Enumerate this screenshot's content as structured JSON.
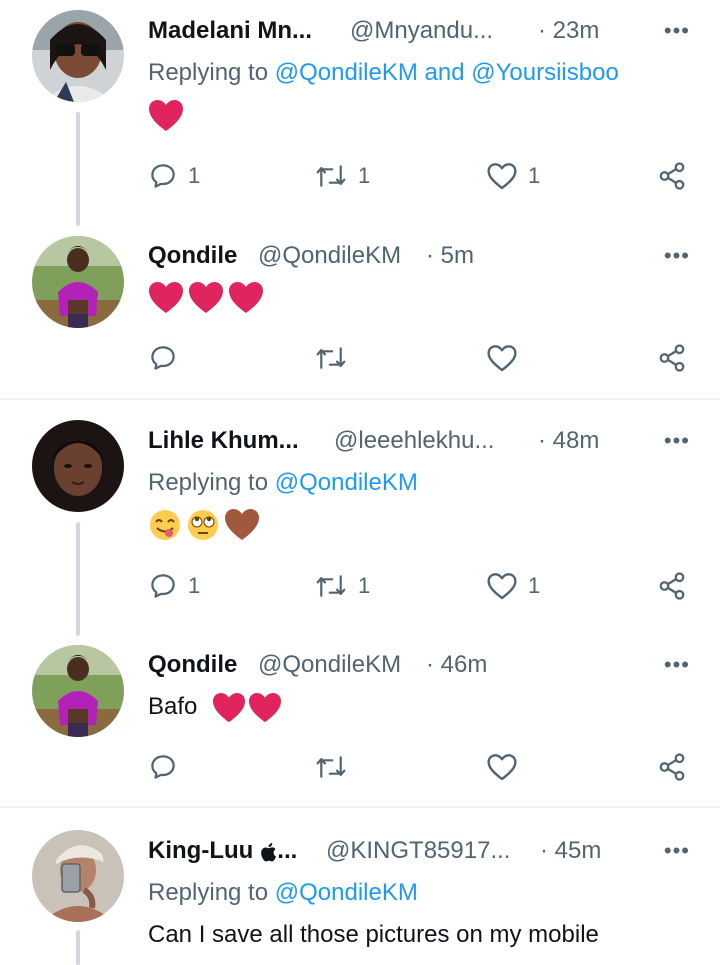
{
  "colors": {
    "link": "#1d9bf0",
    "secondary": "#536471",
    "heart": "#e0245e",
    "thread_line": "#cfd9de"
  },
  "tweets": [
    {
      "name": "Madelani Mn...",
      "handle": "@Mnyandu...",
      "time": "· 23m",
      "reply_prefix": "Replying to",
      "mentions": [
        "@QondileKM",
        "and",
        "@Yoursiisboo"
      ],
      "emojis": [
        "red-heart"
      ],
      "reply_count": "1",
      "retweet_count": "1",
      "like_count": "1"
    },
    {
      "name": "Qondile",
      "handle": "@QondileKM",
      "time": "· 5m",
      "emojis": [
        "red-heart",
        "red-heart",
        "red-heart"
      ],
      "reply_count": "",
      "retweet_count": "",
      "like_count": ""
    },
    {
      "name": "Lihle Khum...",
      "handle": "@leeehlekhu...",
      "time": "· 48m",
      "reply_prefix": "Replying to",
      "mentions": [
        "@QondileKM"
      ],
      "emojis": [
        "face-savoring-food",
        "face-rolling-eyes",
        "brown-heart"
      ],
      "reply_count": "1",
      "retweet_count": "1",
      "like_count": "1"
    },
    {
      "name": "Qondile",
      "handle": "@QondileKM",
      "time": "· 46m",
      "text": "Bafo",
      "emojis": [
        "red-heart",
        "red-heart"
      ],
      "reply_count": "",
      "retweet_count": "",
      "like_count": ""
    },
    {
      "name": "King-Luu",
      "name_suffix": "...",
      "name_icon": "apple-logo",
      "handle": "@KINGT85917...",
      "time": "· 45m",
      "reply_prefix": "Replying to",
      "mentions": [
        "@QondileKM"
      ],
      "text": "Can I save all those pictures on my mobile"
    }
  ]
}
